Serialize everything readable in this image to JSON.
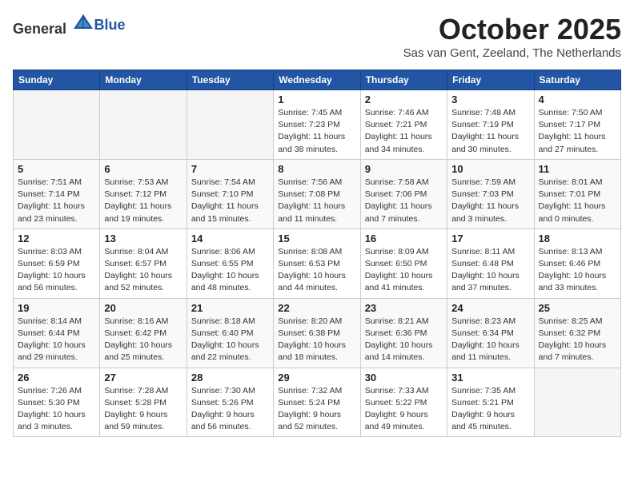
{
  "header": {
    "logo_general": "General",
    "logo_blue": "Blue",
    "month_title": "October 2025",
    "subtitle": "Sas van Gent, Zeeland, The Netherlands"
  },
  "weekdays": [
    "Sunday",
    "Monday",
    "Tuesday",
    "Wednesday",
    "Thursday",
    "Friday",
    "Saturday"
  ],
  "weeks": [
    [
      {
        "day": "",
        "info": ""
      },
      {
        "day": "",
        "info": ""
      },
      {
        "day": "",
        "info": ""
      },
      {
        "day": "1",
        "info": "Sunrise: 7:45 AM\nSunset: 7:23 PM\nDaylight: 11 hours\nand 38 minutes."
      },
      {
        "day": "2",
        "info": "Sunrise: 7:46 AM\nSunset: 7:21 PM\nDaylight: 11 hours\nand 34 minutes."
      },
      {
        "day": "3",
        "info": "Sunrise: 7:48 AM\nSunset: 7:19 PM\nDaylight: 11 hours\nand 30 minutes."
      },
      {
        "day": "4",
        "info": "Sunrise: 7:50 AM\nSunset: 7:17 PM\nDaylight: 11 hours\nand 27 minutes."
      }
    ],
    [
      {
        "day": "5",
        "info": "Sunrise: 7:51 AM\nSunset: 7:14 PM\nDaylight: 11 hours\nand 23 minutes."
      },
      {
        "day": "6",
        "info": "Sunrise: 7:53 AM\nSunset: 7:12 PM\nDaylight: 11 hours\nand 19 minutes."
      },
      {
        "day": "7",
        "info": "Sunrise: 7:54 AM\nSunset: 7:10 PM\nDaylight: 11 hours\nand 15 minutes."
      },
      {
        "day": "8",
        "info": "Sunrise: 7:56 AM\nSunset: 7:08 PM\nDaylight: 11 hours\nand 11 minutes."
      },
      {
        "day": "9",
        "info": "Sunrise: 7:58 AM\nSunset: 7:06 PM\nDaylight: 11 hours\nand 7 minutes."
      },
      {
        "day": "10",
        "info": "Sunrise: 7:59 AM\nSunset: 7:03 PM\nDaylight: 11 hours\nand 3 minutes."
      },
      {
        "day": "11",
        "info": "Sunrise: 8:01 AM\nSunset: 7:01 PM\nDaylight: 11 hours\nand 0 minutes."
      }
    ],
    [
      {
        "day": "12",
        "info": "Sunrise: 8:03 AM\nSunset: 6:59 PM\nDaylight: 10 hours\nand 56 minutes."
      },
      {
        "day": "13",
        "info": "Sunrise: 8:04 AM\nSunset: 6:57 PM\nDaylight: 10 hours\nand 52 minutes."
      },
      {
        "day": "14",
        "info": "Sunrise: 8:06 AM\nSunset: 6:55 PM\nDaylight: 10 hours\nand 48 minutes."
      },
      {
        "day": "15",
        "info": "Sunrise: 8:08 AM\nSunset: 6:53 PM\nDaylight: 10 hours\nand 44 minutes."
      },
      {
        "day": "16",
        "info": "Sunrise: 8:09 AM\nSunset: 6:50 PM\nDaylight: 10 hours\nand 41 minutes."
      },
      {
        "day": "17",
        "info": "Sunrise: 8:11 AM\nSunset: 6:48 PM\nDaylight: 10 hours\nand 37 minutes."
      },
      {
        "day": "18",
        "info": "Sunrise: 8:13 AM\nSunset: 6:46 PM\nDaylight: 10 hours\nand 33 minutes."
      }
    ],
    [
      {
        "day": "19",
        "info": "Sunrise: 8:14 AM\nSunset: 6:44 PM\nDaylight: 10 hours\nand 29 minutes."
      },
      {
        "day": "20",
        "info": "Sunrise: 8:16 AM\nSunset: 6:42 PM\nDaylight: 10 hours\nand 25 minutes."
      },
      {
        "day": "21",
        "info": "Sunrise: 8:18 AM\nSunset: 6:40 PM\nDaylight: 10 hours\nand 22 minutes."
      },
      {
        "day": "22",
        "info": "Sunrise: 8:20 AM\nSunset: 6:38 PM\nDaylight: 10 hours\nand 18 minutes."
      },
      {
        "day": "23",
        "info": "Sunrise: 8:21 AM\nSunset: 6:36 PM\nDaylight: 10 hours\nand 14 minutes."
      },
      {
        "day": "24",
        "info": "Sunrise: 8:23 AM\nSunset: 6:34 PM\nDaylight: 10 hours\nand 11 minutes."
      },
      {
        "day": "25",
        "info": "Sunrise: 8:25 AM\nSunset: 6:32 PM\nDaylight: 10 hours\nand 7 minutes."
      }
    ],
    [
      {
        "day": "26",
        "info": "Sunrise: 7:26 AM\nSunset: 5:30 PM\nDaylight: 10 hours\nand 3 minutes."
      },
      {
        "day": "27",
        "info": "Sunrise: 7:28 AM\nSunset: 5:28 PM\nDaylight: 9 hours\nand 59 minutes."
      },
      {
        "day": "28",
        "info": "Sunrise: 7:30 AM\nSunset: 5:26 PM\nDaylight: 9 hours\nand 56 minutes."
      },
      {
        "day": "29",
        "info": "Sunrise: 7:32 AM\nSunset: 5:24 PM\nDaylight: 9 hours\nand 52 minutes."
      },
      {
        "day": "30",
        "info": "Sunrise: 7:33 AM\nSunset: 5:22 PM\nDaylight: 9 hours\nand 49 minutes."
      },
      {
        "day": "31",
        "info": "Sunrise: 7:35 AM\nSunset: 5:21 PM\nDaylight: 9 hours\nand 45 minutes."
      },
      {
        "day": "",
        "info": ""
      }
    ]
  ]
}
